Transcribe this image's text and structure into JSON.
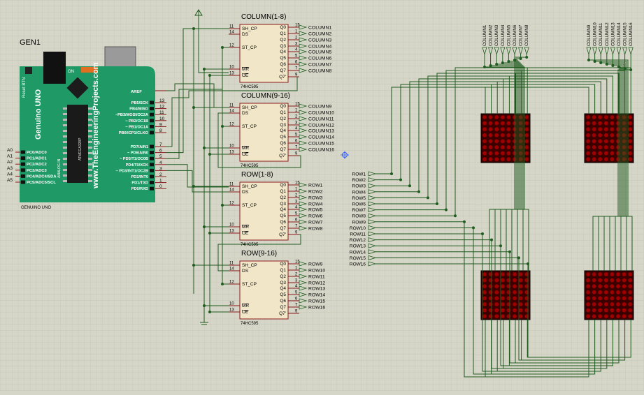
{
  "generator": {
    "ref": "GEN1",
    "label": "GENUINO UNO",
    "site": "www.TheEngineeringProjects.com",
    "board_name": "Genuino UNO",
    "reset_label": "Reset BTN",
    "on_label": "ON",
    "analog_label": "ANALOG IN",
    "chip_label": "ATMEGA328P",
    "analog_pins": [
      {
        "num": "A0",
        "name": "PC0/ADC0"
      },
      {
        "num": "A1",
        "name": "PC1/ADC1"
      },
      {
        "num": "A2",
        "name": "PC2/ADC2"
      },
      {
        "num": "A3",
        "name": "PC3/ADC3"
      },
      {
        "num": "A4",
        "name": "PC4/ADC4/SDA"
      },
      {
        "num": "A5",
        "name": "PC5/ADC5/SCL"
      }
    ],
    "aref": "AREF",
    "digital_pins_high": [
      {
        "num": "13",
        "name": "PB5/SCK"
      },
      {
        "num": "12",
        "name": "PB4/MISO"
      },
      {
        "num": "11",
        "name": "~PB3/MOSI/OC2A"
      },
      {
        "num": "10",
        "name": "~ PB2/OC1B"
      },
      {
        "num": "9",
        "name": "~ PB1/OC1A"
      },
      {
        "num": "8",
        "name": "PB0/ICP1/CLKO"
      }
    ],
    "digital_pins_low": [
      {
        "num": "7",
        "name": "PD7/AIN1"
      },
      {
        "num": "6",
        "name": "~ PD6/AIN0"
      },
      {
        "num": "5",
        "name": "~ PD5/T1/OC0B"
      },
      {
        "num": "4",
        "name": "PD4/T0/XCK"
      },
      {
        "num": "3",
        "name": "~ PD3/INT1/OC2B"
      },
      {
        "num": "2",
        "name": "PD2/INT0"
      },
      {
        "num": "1",
        "name": "PD1/TXD"
      },
      {
        "num": "0",
        "name": "PD0/RXD"
      }
    ]
  },
  "shift_registers": [
    {
      "title": "COLUMN(1-8)",
      "part": "74HC595",
      "outputs": [
        "COLUMN1",
        "COLUMN2",
        "COLUMN3",
        "COLUMN4",
        "COLUMN5",
        "COLUMN6",
        "COLUMN7",
        "COLUMN8"
      ]
    },
    {
      "title": "COLUMN(9-16)",
      "part": "74HC595",
      "outputs": [
        "COLUMN9",
        "COLUMN10",
        "COLUMN11",
        "COLUMN12",
        "COLUMN13",
        "COLUMN14",
        "COLUMN15",
        "COLUMN16"
      ]
    },
    {
      "title": "ROW(1-8)",
      "part": "74HC595",
      "outputs": [
        "ROW1",
        "ROW2",
        "ROW3",
        "ROW4",
        "ROW5",
        "ROW6",
        "ROW7",
        "ROW8"
      ]
    },
    {
      "title": "ROW(9-16)",
      "part": "74HC595",
      "outputs": [
        "ROW9",
        "ROW10",
        "ROW11",
        "ROW12",
        "ROW13",
        "ROW14",
        "ROW15",
        "ROW16"
      ]
    }
  ],
  "sr_pins_left": [
    {
      "num": "11",
      "name": "SH_CP"
    },
    {
      "num": "14",
      "name": "DS"
    },
    {
      "num": "12",
      "name": "ST_CP"
    },
    {
      "num": "10",
      "name": "MR"
    },
    {
      "num": "13",
      "name": "OE"
    }
  ],
  "sr_pins_right": [
    {
      "num": "15",
      "name": "Q0"
    },
    {
      "num": "1",
      "name": "Q1"
    },
    {
      "num": "2",
      "name": "Q2"
    },
    {
      "num": "3",
      "name": "Q3"
    },
    {
      "num": "4",
      "name": "Q4"
    },
    {
      "num": "5",
      "name": "Q5"
    },
    {
      "num": "6",
      "name": "Q6"
    },
    {
      "num": "7",
      "name": "Q7"
    },
    {
      "num": "9",
      "name": "Q7'"
    }
  ],
  "matrix_row_inputs": [
    "ROW1",
    "ROW2",
    "ROW3",
    "ROW4",
    "ROW5",
    "ROW6",
    "ROW7",
    "ROW8",
    "ROW9",
    "ROW10",
    "ROW11",
    "ROW12",
    "ROW13",
    "ROW14",
    "ROW15",
    "ROW16"
  ],
  "matrix_col_inputs_left": [
    "COLUMN1",
    "COLUMN2",
    "COLUMN3",
    "COLUMN4",
    "COLUMN5",
    "COLUMN6",
    "COLUMN7",
    "COLUMN8"
  ],
  "matrix_col_inputs_right": [
    "COLUMN9",
    "COLUMN10",
    "COLUMN11",
    "COLUMN12",
    "COLUMN13",
    "COLUMN14",
    "COLUMN15",
    "COLUMN16"
  ],
  "colors": {
    "background": "#d6d6c8",
    "grid": "#c4c4b4",
    "wire": "#1f5c1f",
    "pin": "#8b1a1a",
    "ic_fill": "#f2e6c8",
    "ic_border": "#8b1a1a",
    "board": "#1f9a66",
    "led_off": "#7a0000",
    "led_bg": "#3a0000",
    "text": "#000000"
  }
}
